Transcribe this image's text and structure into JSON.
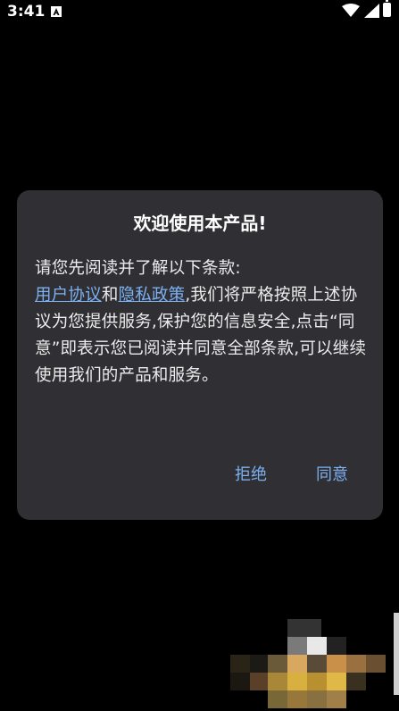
{
  "status_bar": {
    "time": "3:41",
    "icons": [
      "a-notification-icon",
      "wifi-icon",
      "signal-icon",
      "battery-icon"
    ]
  },
  "dialog": {
    "title": "欢迎使用本产品!",
    "intro": "请您先阅读并了解以下条款:",
    "link_user_agreement": "用户协议",
    "conj": "和",
    "link_privacy_policy": "隐私政策",
    "body_rest": ",我们将严格按照上述协议为您提供服务,保护您的信息安全,点击“同意”即表示您已阅读并同意全部条款,可以继续使用我们的产品和服务。",
    "reject_label": "拒绝",
    "agree_label": "同意"
  },
  "colors": {
    "background": "#000000",
    "dialog_bg": "#303034",
    "link": "#7cb0f0",
    "text": "#ececec"
  }
}
